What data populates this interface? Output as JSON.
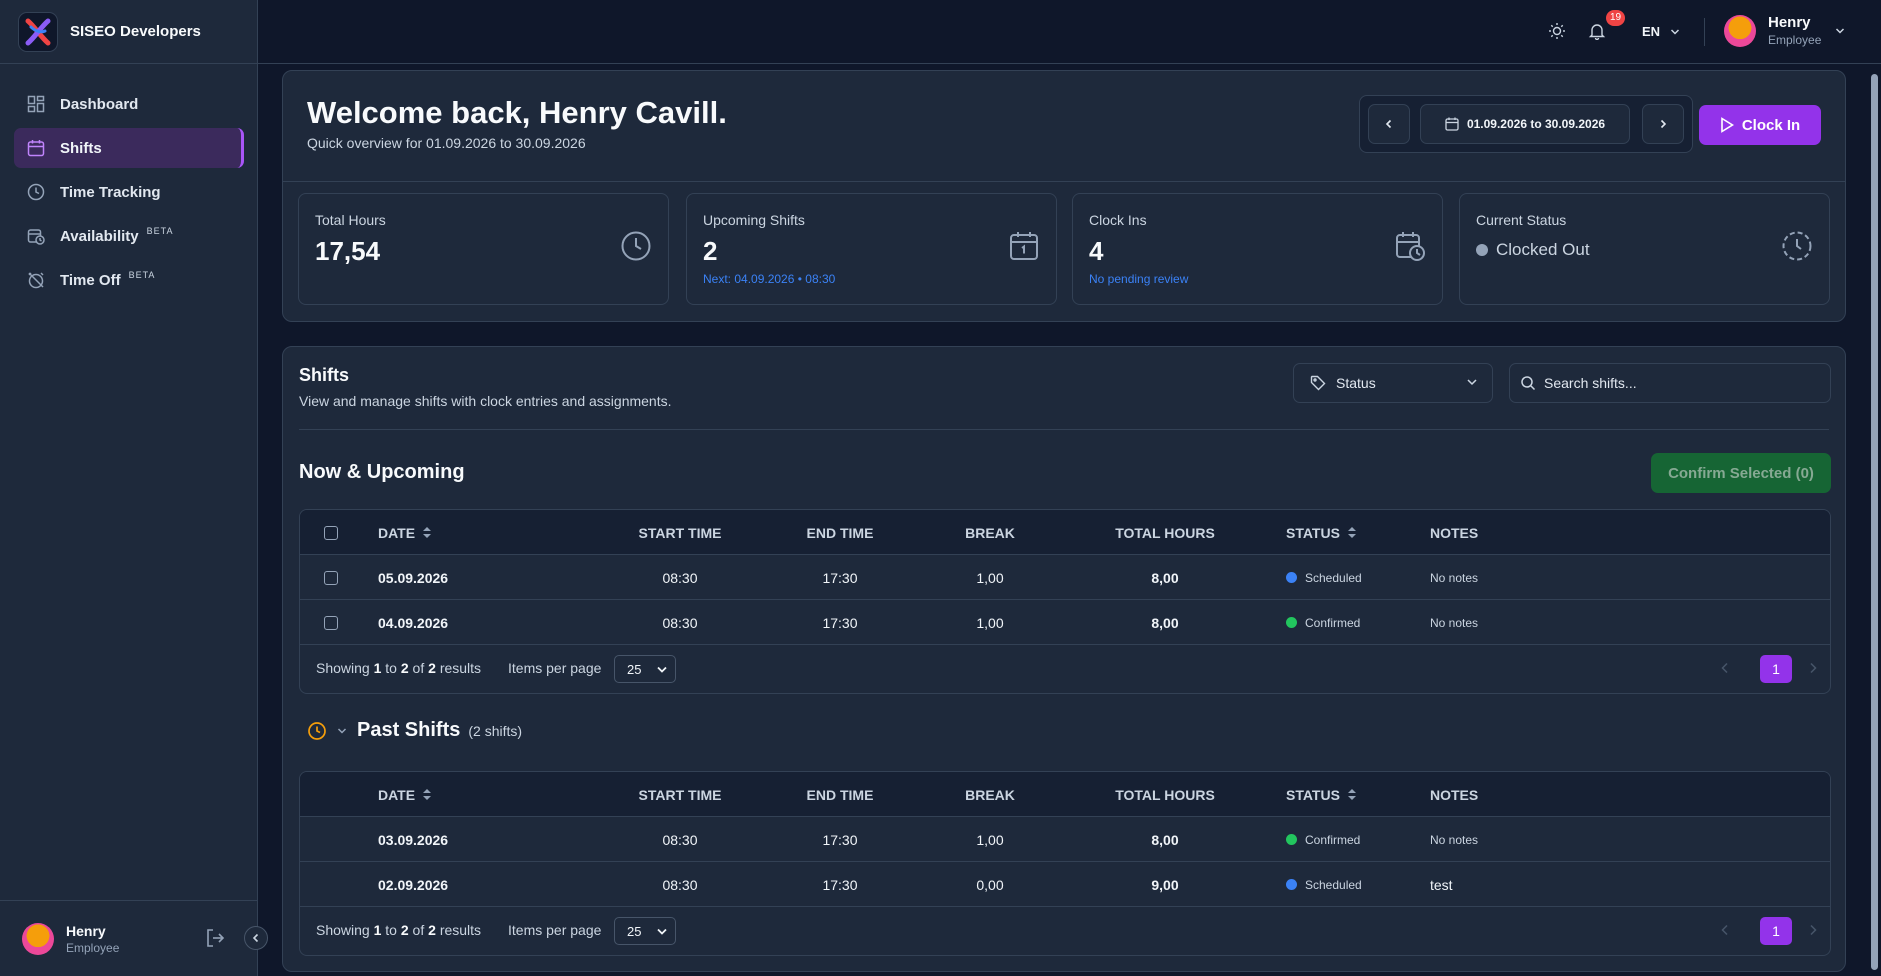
{
  "brand": {
    "name": "SISEO Developers"
  },
  "sidebar": {
    "items": [
      {
        "label": "Dashboard",
        "icon": "dashboard-icon"
      },
      {
        "label": "Shifts",
        "icon": "calendar-icon",
        "active": true
      },
      {
        "label": "Time Tracking",
        "icon": "clock-icon"
      },
      {
        "label": "Availability",
        "icon": "calendar-clock-icon",
        "badge": "BETA"
      },
      {
        "label": "Time Off",
        "icon": "alarm-off-icon",
        "badge": "BETA"
      }
    ],
    "user": {
      "name": "Henry",
      "role": "Employee"
    }
  },
  "topbar": {
    "notifications": "19",
    "language": "EN",
    "user": {
      "name": "Henry",
      "role": "Employee"
    }
  },
  "welcome": {
    "title": "Welcome back, Henry Cavill.",
    "subtitle": "Quick overview for 01.09.2026 to 30.09.2026",
    "range": "01.09.2026 to 30.09.2026",
    "clock_in": "Clock In"
  },
  "stats": {
    "total_hours": {
      "label": "Total Hours",
      "value": "17,54"
    },
    "upcoming": {
      "label": "Upcoming Shifts",
      "value": "2",
      "hint": "Next: 04.09.2026 • 08:30"
    },
    "clock_ins": {
      "label": "Clock Ins",
      "value": "4",
      "hint": "No pending review"
    },
    "status": {
      "label": "Current Status",
      "value": "Clocked Out"
    }
  },
  "shifts": {
    "title": "Shifts",
    "description": "View and manage shifts with clock entries and assignments.",
    "status_filter": "Status",
    "search_placeholder": "Search shifts...",
    "upcoming_title": "Now & Upcoming",
    "confirm_label": "Confirm Selected (0)",
    "columns": [
      "Date",
      "Start Time",
      "End Time",
      "Break",
      "Total Hours",
      "Status",
      "Notes"
    ],
    "upcoming_rows": [
      {
        "date": "05.09.2026",
        "start": "08:30",
        "end": "17:30",
        "break": "1,00",
        "total": "8,00",
        "status": "Scheduled",
        "notes": "No notes"
      },
      {
        "date": "04.09.2026",
        "start": "08:30",
        "end": "17:30",
        "break": "1,00",
        "total": "8,00",
        "status": "Confirmed",
        "notes": "No notes"
      }
    ],
    "upcoming_footer": {
      "from": "1",
      "to": "2",
      "total": "2",
      "per_page": "25",
      "page": "1"
    },
    "past_title": "Past Shifts",
    "past_count": "(2 shifts)",
    "past_rows": [
      {
        "date": "03.09.2026",
        "start": "08:30",
        "end": "17:30",
        "break": "1,00",
        "total": "8,00",
        "status": "Confirmed",
        "notes": "No notes"
      },
      {
        "date": "02.09.2026",
        "start": "08:30",
        "end": "17:30",
        "break": "0,00",
        "total": "9,00",
        "status": "Scheduled",
        "notes": "test"
      }
    ],
    "past_footer": {
      "from": "1",
      "to": "2",
      "total": "2",
      "per_page": "25",
      "page": "1"
    },
    "labels": {
      "showing": "Showing",
      "to": "to",
      "of": "of",
      "results": "results",
      "items_per_page": "Items per page"
    }
  },
  "colors": {
    "accent": "#9333ea",
    "scheduled": "#3b82f6",
    "confirmed": "#22c55e",
    "confirm_button": "#166534"
  }
}
